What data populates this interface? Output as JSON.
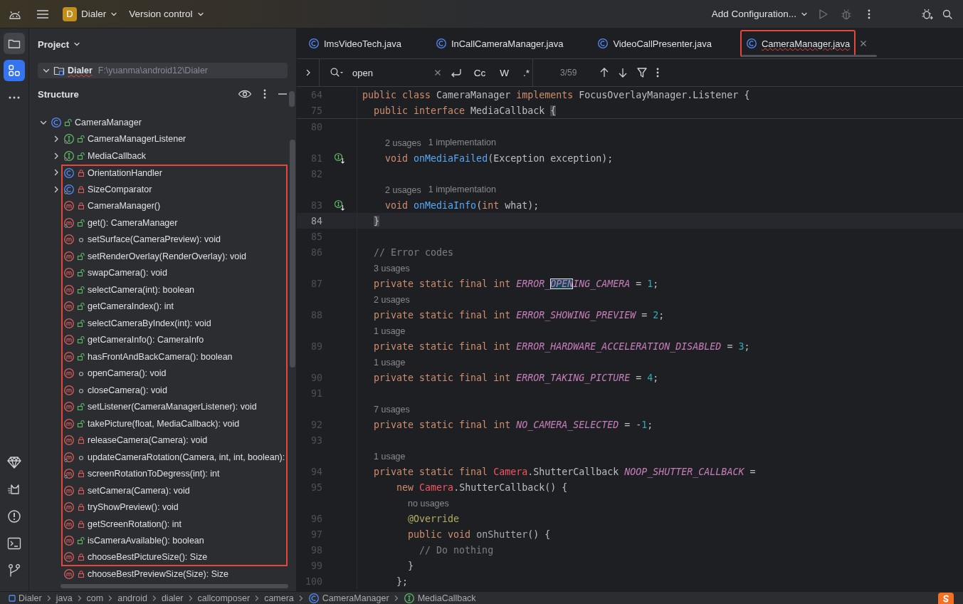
{
  "toolbar": {
    "project_badge": "D",
    "project": "Dialer",
    "vcs": "Version control",
    "run_config": "Add Configuration..."
  },
  "tool_windows": {
    "top": [
      {
        "kind": "folder",
        "open": true,
        "selected": false
      },
      {
        "kind": "structure",
        "open": true,
        "selected": true
      }
    ],
    "bottom": [
      {
        "kind": "gem"
      },
      {
        "kind": "cat"
      },
      {
        "kind": "problems"
      },
      {
        "kind": "terminal"
      },
      {
        "kind": "git"
      }
    ]
  },
  "project_panel": {
    "title": "Project",
    "root": {
      "name": "Dialer",
      "path": "F:\\yuanma\\android12\\Dialer",
      "expanded": true,
      "error": true
    }
  },
  "structure": {
    "title": "Structure",
    "tree": [
      {
        "label": "CameraManager",
        "kind": "class",
        "public": true,
        "private": false,
        "static": false,
        "expanded": true,
        "highlighted": false,
        "children": [
          {
            "label": "CameraManagerListener",
            "kind": "interface",
            "public": true,
            "private": false,
            "static": true,
            "expanded": false,
            "highlighted": false
          },
          {
            "label": "MediaCallback",
            "kind": "interface",
            "public": true,
            "private": false,
            "static": true,
            "expanded": false,
            "highlighted": false
          },
          {
            "label": "OrientationHandler",
            "kind": "class",
            "public": false,
            "private": true,
            "static": false,
            "expanded": false,
            "highlighted": true
          },
          {
            "label": "SizeComparator",
            "kind": "class",
            "public": false,
            "private": true,
            "static": true,
            "expanded": false,
            "highlighted": true
          },
          {
            "label": "CameraManager()",
            "kind": "method",
            "public": false,
            "private": true,
            "static": false,
            "highlighted": true
          },
          {
            "label": "get(): CameraManager",
            "kind": "method",
            "public": true,
            "private": false,
            "static": true,
            "highlighted": true
          },
          {
            "label": "setSurface(CameraPreview): void",
            "kind": "method",
            "public": false,
            "private": false,
            "static": false,
            "highlighted": true
          },
          {
            "label": "setRenderOverlay(RenderOverlay): void",
            "kind": "method",
            "public": true,
            "private": false,
            "static": false,
            "highlighted": true
          },
          {
            "label": "swapCamera(): void",
            "kind": "method",
            "public": true,
            "private": false,
            "static": false,
            "highlighted": true
          },
          {
            "label": "selectCamera(int): boolean",
            "kind": "method",
            "public": true,
            "private": false,
            "static": false,
            "highlighted": true
          },
          {
            "label": "getCameraIndex(): int",
            "kind": "method",
            "public": true,
            "private": false,
            "static": false,
            "highlighted": true
          },
          {
            "label": "selectCameraByIndex(int): void",
            "kind": "method",
            "public": true,
            "private": false,
            "static": false,
            "highlighted": true
          },
          {
            "label": "getCameraInfo(): CameraInfo",
            "kind": "method",
            "public": true,
            "private": false,
            "static": false,
            "highlighted": true
          },
          {
            "label": "hasFrontAndBackCamera(): boolean",
            "kind": "method",
            "public": true,
            "private": false,
            "static": false,
            "highlighted": true
          },
          {
            "label": "openCamera(): void",
            "kind": "method",
            "public": false,
            "private": false,
            "static": false,
            "highlighted": true
          },
          {
            "label": "closeCamera(): void",
            "kind": "method",
            "public": false,
            "private": false,
            "static": false,
            "highlighted": true
          },
          {
            "label": "setListener(CameraManagerListener): void",
            "kind": "method",
            "public": true,
            "private": false,
            "static": false,
            "highlighted": true
          },
          {
            "label": "takePicture(float, MediaCallback): void",
            "kind": "method",
            "public": true,
            "private": false,
            "static": false,
            "highlighted": true
          },
          {
            "label": "releaseCamera(Camera): void",
            "kind": "method",
            "public": false,
            "private": true,
            "static": false,
            "highlighted": true
          },
          {
            "label": "updateCameraRotation(Camera, int, int, boolean):",
            "kind": "method",
            "public": false,
            "private": false,
            "static": true,
            "highlighted": true
          },
          {
            "label": "screenRotationToDegress(int): int",
            "kind": "method",
            "public": false,
            "private": true,
            "static": true,
            "highlighted": true
          },
          {
            "label": "setCamera(Camera): void",
            "kind": "method",
            "public": false,
            "private": true,
            "static": false,
            "highlighted": true
          },
          {
            "label": "tryShowPreview(): void",
            "kind": "method",
            "public": false,
            "private": true,
            "static": false,
            "highlighted": true
          },
          {
            "label": "getScreenRotation(): int",
            "kind": "method",
            "public": false,
            "private": true,
            "static": false,
            "highlighted": true
          },
          {
            "label": "isCameraAvailable(): boolean",
            "kind": "method",
            "public": true,
            "private": false,
            "static": false,
            "highlighted": true
          },
          {
            "label": "chooseBestPictureSize(): Size",
            "kind": "method",
            "public": false,
            "private": true,
            "static": false,
            "highlighted": true
          },
          {
            "label": "chooseBestPreviewSize(Size): Size",
            "kind": "method",
            "public": false,
            "private": true,
            "static": false,
            "highlighted": false
          }
        ]
      }
    ]
  },
  "tabs": [
    {
      "label": "ImsVideoTech.java",
      "selected": false,
      "highlighted": false,
      "error": false
    },
    {
      "label": "InCallCameraManager.java",
      "selected": false,
      "highlighted": false,
      "error": false
    },
    {
      "label": "VideoCallPresenter.java",
      "selected": false,
      "highlighted": false,
      "error": false
    },
    {
      "label": "CameraManager.java",
      "selected": true,
      "highlighted": true,
      "error": true
    }
  ],
  "find": {
    "query": "open",
    "options": [
      {
        "label": "Cc",
        "selected": false
      },
      {
        "label": "W",
        "selected": false
      },
      {
        "label": ".*",
        "selected": false
      }
    ],
    "count": "3/59"
  },
  "editor": {
    "sticky": [
      {
        "number": "64",
        "tokens": [
          {
            "kind": "kw",
            "text": "public class "
          },
          {
            "kind": "plain",
            "text": "CameraManager "
          },
          {
            "kind": "kw",
            "text": "implements "
          },
          {
            "kind": "plain",
            "text": "FocusOverlayManager.Listener {"
          }
        ]
      },
      {
        "number": "75",
        "tokens": [
          {
            "kind": "kw",
            "text": "  public interface "
          },
          {
            "kind": "plain",
            "text": "MediaCallback "
          },
          {
            "kind": "brace",
            "text": "{"
          }
        ]
      }
    ],
    "lines": [
      {
        "kind": "code",
        "number": "80"
      },
      {
        "kind": "hint",
        "tokens": [
          {
            "kind": "hint",
            "text": "    2 usages"
          },
          {
            "kind": "hint",
            "text": "1 implementation"
          }
        ]
      },
      {
        "kind": "code",
        "number": "81",
        "implemented": true,
        "tokens": [
          {
            "kind": "kw",
            "text": "    void "
          },
          {
            "kind": "fn",
            "text": "onMediaFailed"
          },
          {
            "kind": "plain",
            "text": "(Exception exception);"
          }
        ]
      },
      {
        "kind": "code",
        "number": "82"
      },
      {
        "kind": "hint",
        "tokens": [
          {
            "kind": "hint",
            "text": "    2 usages"
          },
          {
            "kind": "hint",
            "text": "1 implementation"
          }
        ]
      },
      {
        "kind": "code",
        "number": "83",
        "implemented": true,
        "tokens": [
          {
            "kind": "kw",
            "text": "    void "
          },
          {
            "kind": "fn",
            "text": "onMediaInfo"
          },
          {
            "kind": "plain",
            "text": "("
          },
          {
            "kind": "kw",
            "text": "int "
          },
          {
            "kind": "plain",
            "text": "what);"
          }
        ]
      },
      {
        "kind": "code",
        "number": "84",
        "current": true,
        "tokens": [
          {
            "kind": "brace",
            "text": "  }"
          }
        ]
      },
      {
        "kind": "code",
        "number": "85"
      },
      {
        "kind": "code",
        "number": "86",
        "tokens": [
          {
            "kind": "comment",
            "text": "  // Error codes"
          }
        ]
      },
      {
        "kind": "hint",
        "tokens": [
          {
            "kind": "hint",
            "text": "  3 usages"
          }
        ]
      },
      {
        "kind": "code",
        "number": "87",
        "tokens": [
          {
            "kind": "kw",
            "text": "  private static final int "
          },
          {
            "kind": "const",
            "text": "ERROR_"
          },
          {
            "kind": "match",
            "text": "OPEN"
          },
          {
            "kind": "const",
            "text": "ING_CAMERA"
          },
          {
            "kind": "plain",
            "text": " = "
          },
          {
            "kind": "num",
            "text": "1"
          },
          {
            "kind": "plain",
            "text": ";"
          }
        ]
      },
      {
        "kind": "hint",
        "tokens": [
          {
            "kind": "hint",
            "text": "  2 usages"
          }
        ]
      },
      {
        "kind": "code",
        "number": "88",
        "tokens": [
          {
            "kind": "kw",
            "text": "  private static final int "
          },
          {
            "kind": "const",
            "text": "ERROR_SHOWING_PREVIEW"
          },
          {
            "kind": "plain",
            "text": " = "
          },
          {
            "kind": "num",
            "text": "2"
          },
          {
            "kind": "plain",
            "text": ";"
          }
        ]
      },
      {
        "kind": "hint",
        "tokens": [
          {
            "kind": "hint",
            "text": "  1 usage"
          }
        ]
      },
      {
        "kind": "code",
        "number": "89",
        "tokens": [
          {
            "kind": "kw",
            "text": "  private static final int "
          },
          {
            "kind": "const",
            "text": "ERROR_HARDWARE_ACCELERATION_DISABLED"
          },
          {
            "kind": "plain",
            "text": " = "
          },
          {
            "kind": "num",
            "text": "3"
          },
          {
            "kind": "plain",
            "text": ";"
          }
        ]
      },
      {
        "kind": "hint",
        "tokens": [
          {
            "kind": "hint",
            "text": "  1 usage"
          }
        ]
      },
      {
        "kind": "code",
        "number": "90",
        "tokens": [
          {
            "kind": "kw",
            "text": "  private static final int "
          },
          {
            "kind": "const",
            "text": "ERROR_TAKING_PICTURE"
          },
          {
            "kind": "plain",
            "text": " = "
          },
          {
            "kind": "num",
            "text": "4"
          },
          {
            "kind": "plain",
            "text": ";"
          }
        ]
      },
      {
        "kind": "code",
        "number": "91"
      },
      {
        "kind": "hint",
        "tokens": [
          {
            "kind": "hint",
            "text": "  7 usages"
          }
        ]
      },
      {
        "kind": "code",
        "number": "92",
        "tokens": [
          {
            "kind": "kw",
            "text": "  private static final int "
          },
          {
            "kind": "const",
            "text": "NO_CAMERA_SELECTED"
          },
          {
            "kind": "plain",
            "text": " = -"
          },
          {
            "kind": "num",
            "text": "1"
          },
          {
            "kind": "plain",
            "text": ";"
          }
        ]
      },
      {
        "kind": "code",
        "number": "93"
      },
      {
        "kind": "hint",
        "tokens": [
          {
            "kind": "hint",
            "text": "  1 usage"
          }
        ]
      },
      {
        "kind": "code",
        "number": "94",
        "tokens": [
          {
            "kind": "kw",
            "text": "  private static final "
          },
          {
            "kind": "cls",
            "text": "Camera"
          },
          {
            "kind": "plain",
            "text": ".ShutterCallback "
          },
          {
            "kind": "const",
            "text": "NOOP_SHUTTER_CALLBACK"
          },
          {
            "kind": "plain",
            "text": " ="
          }
        ]
      },
      {
        "kind": "code",
        "number": "95",
        "tokens": [
          {
            "kind": "kw",
            "text": "      new "
          },
          {
            "kind": "cls",
            "text": "Camera"
          },
          {
            "kind": "plain",
            "text": ".ShutterCallback() {"
          }
        ]
      },
      {
        "kind": "hint",
        "tokens": [
          {
            "kind": "hint",
            "text": "        no usages"
          }
        ]
      },
      {
        "kind": "code",
        "number": "96",
        "tokens": [
          {
            "kind": "ann",
            "text": "        @Override"
          }
        ]
      },
      {
        "kind": "code",
        "number": "97",
        "tokens": [
          {
            "kind": "kw",
            "text": "        public void "
          },
          {
            "kind": "unused",
            "text": "onShutter"
          },
          {
            "kind": "plain",
            "text": "() {"
          }
        ]
      },
      {
        "kind": "code",
        "number": "98",
        "tokens": [
          {
            "kind": "comment",
            "text": "          // Do nothing"
          }
        ]
      },
      {
        "kind": "code",
        "number": "99",
        "tokens": [
          {
            "kind": "plain",
            "text": "        }"
          }
        ]
      },
      {
        "kind": "code",
        "number": "100",
        "tokens": [
          {
            "kind": "plain",
            "text": "      };"
          }
        ]
      }
    ]
  },
  "breadcrumbs": [
    {
      "label": "Dialer",
      "kind": "module"
    },
    {
      "label": "java",
      "kind": "folder"
    },
    {
      "label": "com",
      "kind": "folder"
    },
    {
      "label": "android",
      "kind": "folder"
    },
    {
      "label": "dialer",
      "kind": "folder"
    },
    {
      "label": "callcomposer",
      "kind": "folder"
    },
    {
      "label": "camera",
      "kind": "folder"
    },
    {
      "label": "CameraManager",
      "kind": "class"
    },
    {
      "label": "MediaCallback",
      "kind": "interface"
    }
  ]
}
